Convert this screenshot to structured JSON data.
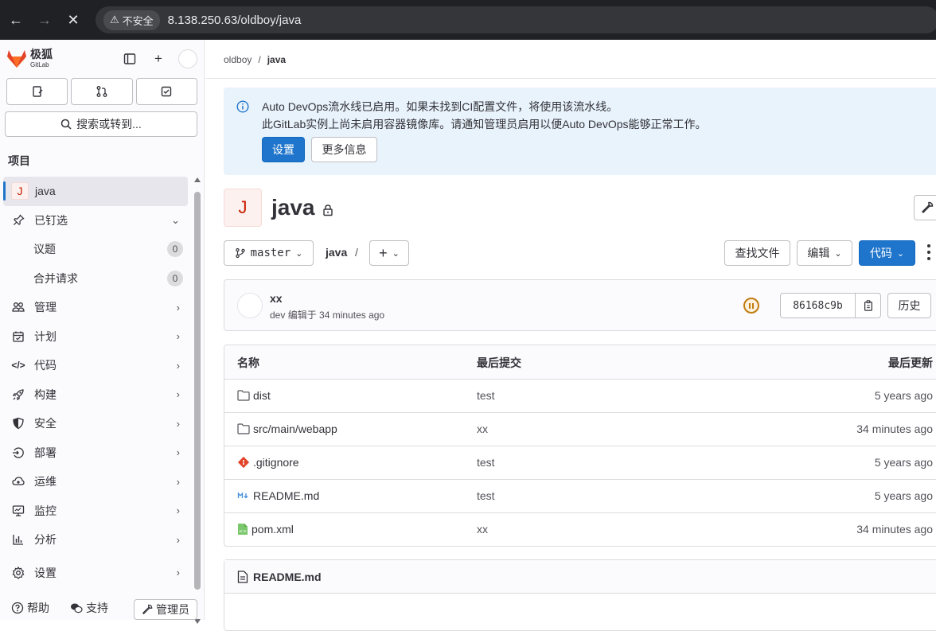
{
  "browser": {
    "security_label": "不安全",
    "url": "8.138.250.63/oldboy/java"
  },
  "sidebar": {
    "logo_line1": "极狐",
    "logo_line2": "GitLab",
    "search_label": "搜索或转到...",
    "section_title": "项目",
    "project": {
      "initial": "J",
      "name": "java"
    },
    "pinned_label": "已钉选",
    "pinned_items": [
      {
        "label": "议题",
        "count": "0"
      },
      {
        "label": "合并请求",
        "count": "0"
      }
    ],
    "nav": [
      {
        "label": "管理",
        "icon": "users-icon"
      },
      {
        "label": "计划",
        "icon": "calendar-icon"
      },
      {
        "label": "代码",
        "icon": "code-icon"
      },
      {
        "label": "构建",
        "icon": "rocket-icon"
      },
      {
        "label": "安全",
        "icon": "shield-icon"
      },
      {
        "label": "部署",
        "icon": "deployments-icon"
      },
      {
        "label": "运维",
        "icon": "cloud-icon"
      },
      {
        "label": "监控",
        "icon": "monitor-icon"
      },
      {
        "label": "分析",
        "icon": "chart-icon"
      },
      {
        "label": "设置",
        "icon": "gear-icon"
      }
    ],
    "bottom": {
      "help": "帮助",
      "support": "支持",
      "admin": "管理员"
    }
  },
  "breadcrumb": {
    "group": "oldboy",
    "project": "java"
  },
  "alert": {
    "line1": "Auto DevOps流水线已启用。如果未找到CI配置文件，将使用该流水线。",
    "line2": "此GitLab实例上尚未启用容器镜像库。请通知管理员启用以便Auto DevOps能够正常工作。",
    "primary_button": "设置",
    "secondary_button": "更多信息"
  },
  "project": {
    "initial": "J",
    "title": "java"
  },
  "toolbar": {
    "branch": "master",
    "path": "java",
    "separator": "/",
    "find_file": "查找文件",
    "edit": "编辑",
    "code": "代码"
  },
  "commit": {
    "message": "xx",
    "author": "dev",
    "meta": "编辑于 34 minutes ago",
    "sha": "86168c9b",
    "history": "历史"
  },
  "files": {
    "headers": {
      "name": "名称",
      "last_commit": "最后提交",
      "last_update": "最后更新"
    },
    "rows": [
      {
        "name": "dist",
        "type": "folder",
        "commit": "test",
        "updated": "5 years ago"
      },
      {
        "name": "src/main/webapp",
        "type": "folder",
        "commit": "xx",
        "updated": "34 minutes ago"
      },
      {
        "name": ".gitignore",
        "type": "git",
        "commit": "test",
        "updated": "5 years ago"
      },
      {
        "name": "README.md",
        "type": "markdown",
        "commit": "test",
        "updated": "5 years ago"
      },
      {
        "name": "pom.xml",
        "type": "xml",
        "commit": "xx",
        "updated": "34 minutes ago"
      }
    ]
  },
  "readme": {
    "title": "README.md"
  },
  "colors": {
    "accent": "#1f75cb",
    "sidebar_bg": "#fbfafd",
    "alert_bg": "#e9f3fc",
    "pipeline": "#c17d10"
  }
}
